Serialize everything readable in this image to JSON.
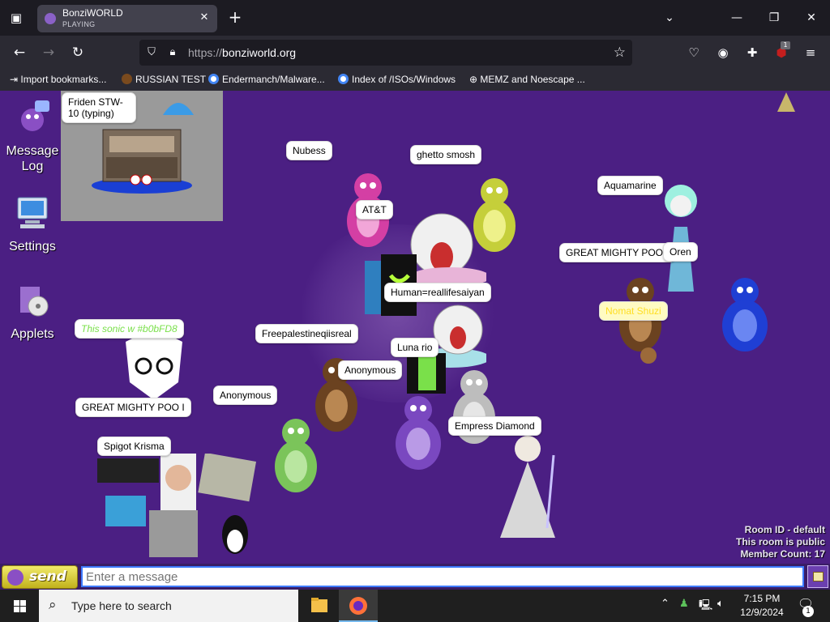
{
  "browser": {
    "tab": {
      "title": "BonziWORLD",
      "status": "PLAYING"
    },
    "url_scheme": "https://",
    "url_host": "bonziworld.org",
    "ext_badge": "1",
    "bookmarks": [
      {
        "label": "Import bookmarks...",
        "icon_color": "#fbfbfe"
      },
      {
        "label": "RUSSIAN TEST",
        "icon_color": "#7a4a1e"
      },
      {
        "label": "Endermanch/Malware...",
        "icon_color": "#ffffff"
      },
      {
        "label": "Index of /ISOs/Windows",
        "icon_color": "#ffffff"
      },
      {
        "label": "MEMZ and Noescape ...",
        "icon_color": "#fbfbfe"
      }
    ]
  },
  "desktop_icons": [
    {
      "label": "Message Log",
      "icon": "message-log-icon"
    },
    {
      "label": "Settings",
      "icon": "settings-computer-icon"
    },
    {
      "label": "Applets",
      "icon": "applets-box-icon"
    }
  ],
  "room": {
    "bubbles": [
      "Friden STW-10 (typing)",
      "Nubess",
      "ghetto smosh",
      "AT&T",
      "Aquamarine",
      "GREAT MIGHTY POO I",
      "Oren",
      "Human=reallifesaiyan",
      "This sonic w #b0bFD8",
      "Freepalestineqiisreal",
      "Luna rio",
      "Anonymous",
      "Anonymous",
      "GREAT MIGHTY POO I",
      "Empress Diamond",
      "Spigot Krisma",
      "Nomat Shuzi"
    ],
    "info": {
      "room_id": "Room ID - default",
      "public": "This room is public",
      "count": "Member Count: 17"
    }
  },
  "chat": {
    "send_label": "send",
    "placeholder": "Enter a message"
  },
  "taskbar": {
    "search_placeholder": "Type here to search",
    "time": "7:15 PM",
    "date": "12/9/2024",
    "notification_count": "1"
  },
  "colors": {
    "room_bg": "#4b1f83",
    "bonzi_purple": "#8a4fc4",
    "input_border": "#3d7bff"
  }
}
